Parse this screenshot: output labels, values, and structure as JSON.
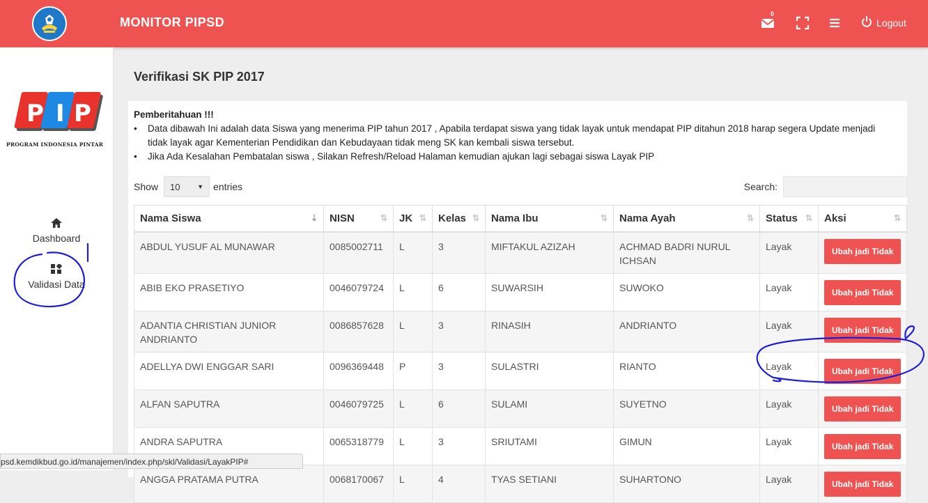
{
  "header": {
    "title": "MONITOR PIPSD",
    "mail_count": "0",
    "logout_label": "Logout"
  },
  "sidebar": {
    "logo_caption": "PROGRAM INDONESIA PINTAR",
    "items": [
      {
        "label": "Dashboard",
        "icon": "home-icon"
      },
      {
        "label": "Validasi Data",
        "icon": "grid-icon"
      }
    ]
  },
  "page": {
    "title": "Verifikasi SK PIP 2017",
    "notice_title": "Pemberitahuan !!!",
    "notice_items": [
      "Data dibawah Ini adalah data Siswa yang menerima PIP tahun 2017 , Apabila terdapat siswa yang tidak layak untuk mendapat PIP ditahun 2018 harap segera Update menjadi tidak layak agar Kementerian Pendidikan dan Kebudayaan tidak meng SK kan kembali siswa tersebut.",
      "Jika Ada Kesalahan Pembatalan siswa , Silakan Refresh/Reload Halaman kemudian ajukan lagi sebagai siswa Layak PIP"
    ]
  },
  "table_controls": {
    "show_label": "Show",
    "entries_value": "10",
    "entries_label": "entries",
    "search_label": "Search:"
  },
  "table": {
    "columns": [
      "Nama Siswa",
      "NISN",
      "JK",
      "Kelas",
      "Nama Ibu",
      "Nama Ayah",
      "Status",
      "Aksi"
    ],
    "action_label": "Ubah jadi Tidak",
    "rows": [
      {
        "nama": "ABDUL YUSUF AL MUNAWAR",
        "nisn": "0085002711",
        "jk": "L",
        "kelas": "3",
        "ibu": "MIFTAKUL AZIZAH",
        "ayah": "ACHMAD BADRI NURUL ICHSAN",
        "status": "Layak"
      },
      {
        "nama": "ABIB EKO PRASETIYO",
        "nisn": "0046079724",
        "jk": "L",
        "kelas": "6",
        "ibu": "SUWARSIH",
        "ayah": "SUWOKO",
        "status": "Layak"
      },
      {
        "nama": "ADANTIA CHRISTIAN JUNIOR ANDRIANTO",
        "nisn": "0086857628",
        "jk": "L",
        "kelas": "3",
        "ibu": "RINASIH",
        "ayah": "ANDRIANTO",
        "status": "Layak"
      },
      {
        "nama": "ADELLYA DWI ENGGAR SARI",
        "nisn": "0096369448",
        "jk": "P",
        "kelas": "3",
        "ibu": "SULASTRI",
        "ayah": "RIANTO",
        "status": "Layak"
      },
      {
        "nama": "ALFAN SAPUTRA",
        "nisn": "0046079725",
        "jk": "L",
        "kelas": "6",
        "ibu": "SULAMI",
        "ayah": "SUYETNO",
        "status": "Layak"
      },
      {
        "nama": "ANDRA SAPUTRA",
        "nisn": "0065318779",
        "jk": "L",
        "kelas": "3",
        "ibu": "SRIUTAMI",
        "ayah": "GIMUN",
        "status": "Layak"
      },
      {
        "nama": "ANGGA PRATAMA PUTRA",
        "nisn": "0068170067",
        "jk": "L",
        "kelas": "4",
        "ibu": "TYAS SETIANI",
        "ayah": "SUHARTONO",
        "status": "Layak"
      }
    ]
  },
  "status_bar": {
    "url": "psd.kemdikbud.go.id/manajemen/index.php/skl/Validasi/LayakPIP#"
  },
  "colors": {
    "header_bg": "#ee5352",
    "status_layak": "#4caf50",
    "annotation": "#1d1dd6"
  }
}
